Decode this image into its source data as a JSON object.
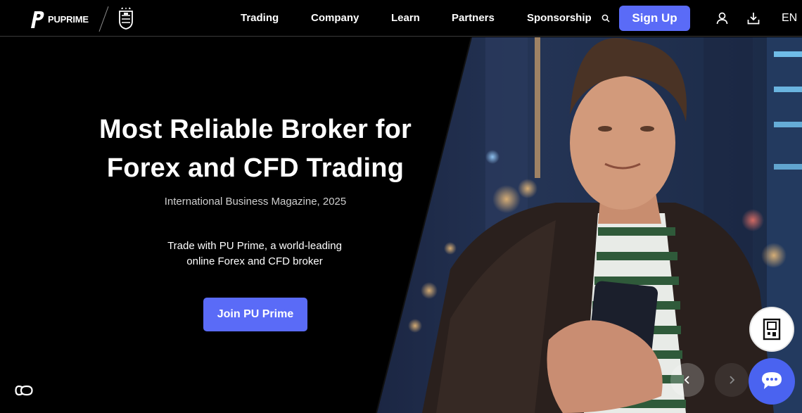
{
  "brand": {
    "name": "PUPRIME",
    "accent": "#5a6bf7"
  },
  "nav": {
    "items": [
      {
        "label": "Trading"
      },
      {
        "label": "Company"
      },
      {
        "label": "Learn"
      },
      {
        "label": "Partners"
      },
      {
        "label": "Sponsorship"
      }
    ],
    "signup_label": "Sign Up",
    "language": "EN",
    "icons": [
      "search-icon",
      "user-icon",
      "download-icon"
    ]
  },
  "hero": {
    "title_line1": "Most Reliable Broker for",
    "title_line2": "Forex and CFD Trading",
    "source": "International Business Magazine, 2025",
    "desc_line1": "Trade with PU Prime, a world-leading",
    "desc_line2": "online Forex and CFD broker",
    "cta_label": "Join PU Prime"
  },
  "floating": {
    "icons": [
      "qr-code-icon",
      "chat-icon",
      "accessibility-icon"
    ],
    "carousel": [
      "chevron-left-icon",
      "chevron-right-icon"
    ]
  }
}
